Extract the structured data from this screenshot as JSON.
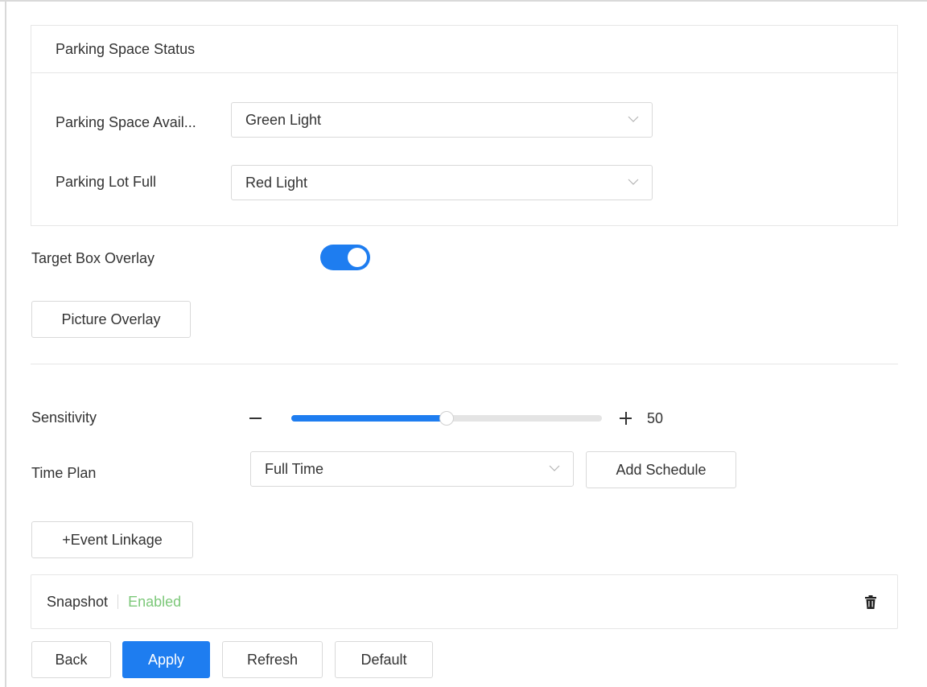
{
  "parking_status": {
    "title": "Parking Space Status",
    "available_label": "Parking Space Avail...",
    "available_value": "Green Light",
    "full_label": "Parking Lot Full",
    "full_value": "Red Light"
  },
  "target_box_overlay": {
    "label": "Target Box Overlay",
    "enabled": true
  },
  "picture_overlay_button": "Picture Overlay",
  "sensitivity": {
    "label": "Sensitivity",
    "value": 50,
    "min": 0,
    "max": 100
  },
  "time_plan": {
    "label": "Time Plan",
    "value": "Full Time",
    "add_schedule_button": "Add Schedule"
  },
  "event_linkage_button": "+Event Linkage",
  "snapshot": {
    "label": "Snapshot",
    "status": "Enabled"
  },
  "actions": {
    "back": "Back",
    "apply": "Apply",
    "refresh": "Refresh",
    "default": "Default"
  },
  "colors": {
    "accent": "#1e7df0",
    "enabled_text": "#7dc87a",
    "border": "#d9d9d9"
  },
  "icons": {
    "dropdown": "chevron-down-icon",
    "delete": "trash-icon"
  }
}
